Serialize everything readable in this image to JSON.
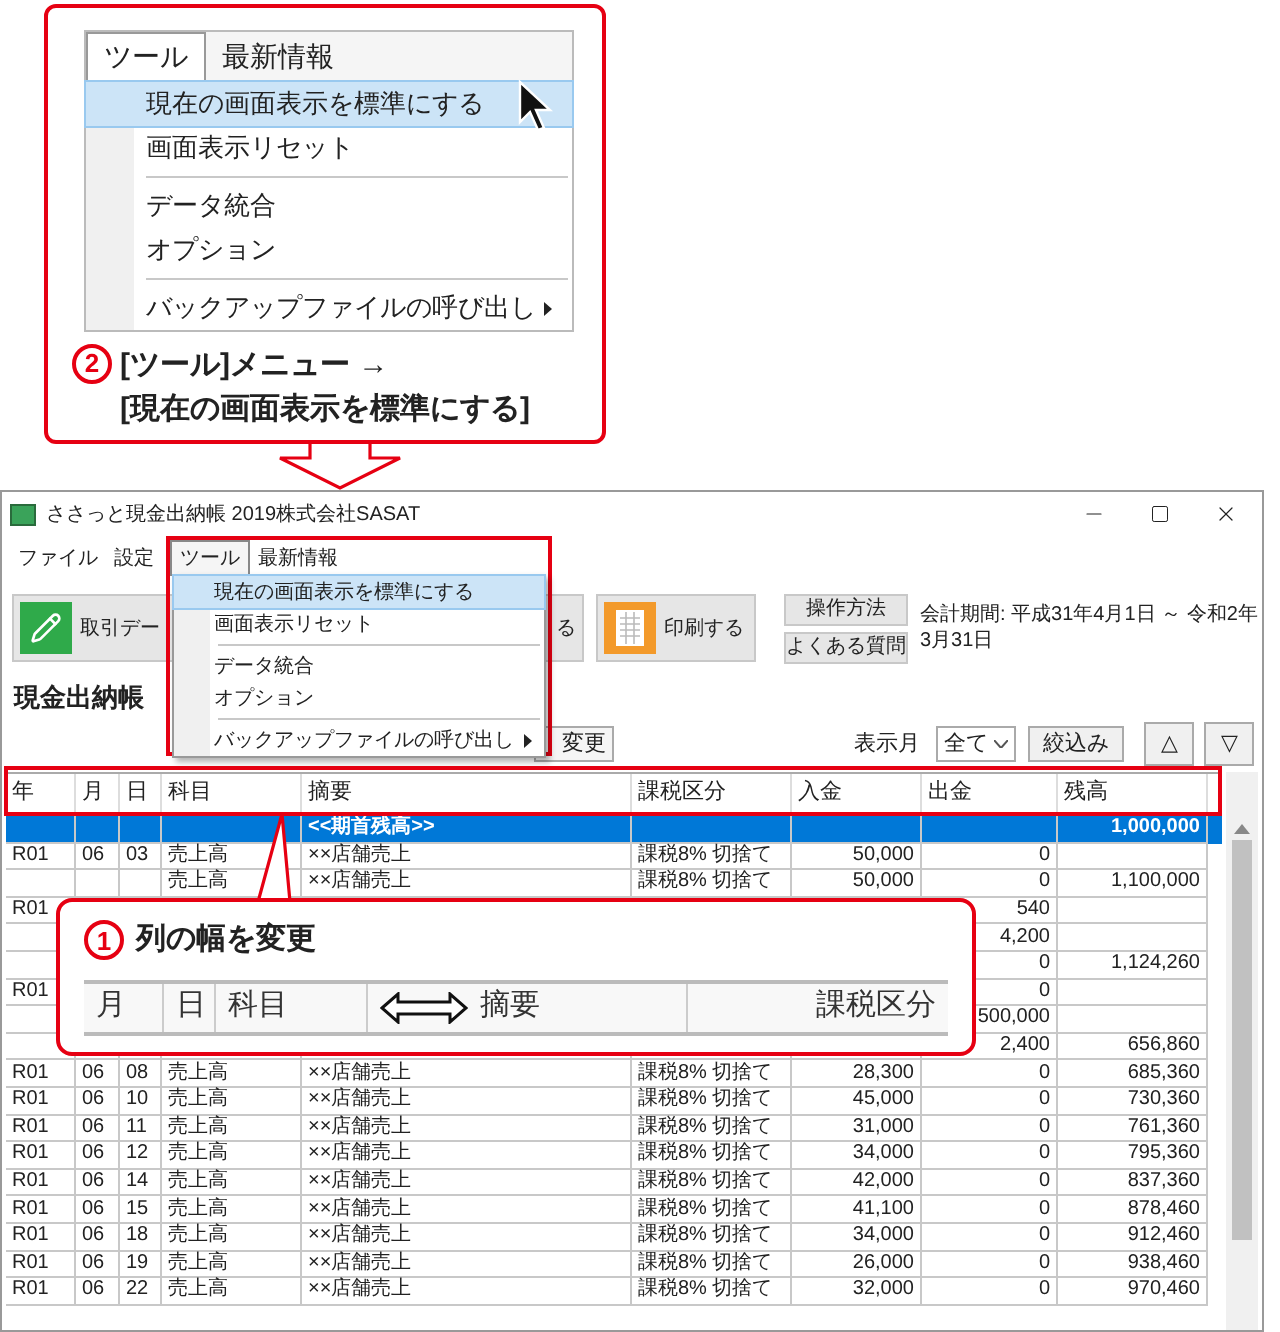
{
  "guide_menu": {
    "menus": [
      {
        "label": "ツール",
        "selected": true
      },
      {
        "label": "最新情報",
        "selected": false
      }
    ],
    "items": [
      {
        "kind": "item",
        "label": "現在の画面表示を標準にする",
        "selected": true,
        "submenu": false
      },
      {
        "kind": "item",
        "label": "画面表示リセット",
        "selected": false,
        "submenu": false
      },
      {
        "kind": "separator"
      },
      {
        "kind": "item",
        "label": "データ統合",
        "selected": false,
        "submenu": false
      },
      {
        "kind": "item",
        "label": "オプション",
        "selected": false,
        "submenu": false
      },
      {
        "kind": "separator"
      },
      {
        "kind": "item",
        "label": "バックアップファイルの呼び出し",
        "selected": false,
        "submenu": true
      }
    ]
  },
  "step2": {
    "number": "2",
    "lines": [
      "[ツール]メニュー →",
      "[現在の画面表示を標準にする]"
    ]
  },
  "window": {
    "title": "ささっと現金出納帳 2019株式会社SASAT"
  },
  "menubar": [
    {
      "label": "ファイル",
      "selected": false
    },
    {
      "label": "設定",
      "selected": false
    },
    {
      "label": "ツール",
      "selected": true
    },
    {
      "label": "最新情報",
      "selected": false
    }
  ],
  "tools_menu": [
    {
      "kind": "item",
      "label": "現在の画面表示を標準にする",
      "selected": true,
      "submenu": false
    },
    {
      "kind": "item",
      "label": "画面表示リセット",
      "selected": false,
      "submenu": false
    },
    {
      "kind": "separator"
    },
    {
      "kind": "item",
      "label": "データ統合",
      "selected": false,
      "submenu": false
    },
    {
      "kind": "item",
      "label": "オプション",
      "selected": false,
      "submenu": false
    },
    {
      "kind": "separator"
    },
    {
      "kind": "item",
      "label": "バックアップファイルの呼び出し",
      "selected": false,
      "submenu": true
    }
  ],
  "toolbar": [
    {
      "kind": "edit",
      "label": "取引デー"
    },
    {
      "kind": "plain",
      "label": "る"
    },
    {
      "kind": "print",
      "label": "印刷する"
    }
  ],
  "help_buttons": [
    "操作方法",
    "よくある質問"
  ],
  "period": "会計期間: 平成31年4月1日 ～ 令和2年3月31日",
  "page_tab": "現金出納帳",
  "change_button": "変更",
  "month_filter": {
    "label": "表示月",
    "value": "全て"
  },
  "filter_button": "絞込み",
  "nav_buttons": [
    "△",
    "▽"
  ],
  "table": {
    "columns": [
      "年",
      "月",
      "日",
      "科目",
      "摘要",
      "課税区分",
      "入金",
      "出金",
      "残高"
    ],
    "rows": [
      {
        "selected": true,
        "cells": [
          null,
          null,
          null,
          null,
          "<<期首残高>>",
          null,
          null,
          null,
          "1,000,000"
        ]
      },
      {
        "selected": false,
        "cells": [
          "R01",
          "06",
          "03",
          "売上高",
          "××店舗売上",
          "課税8% 切捨て",
          "50,000",
          "0",
          null
        ]
      },
      {
        "selected": false,
        "cells": [
          null,
          null,
          null,
          "売上高",
          "××店舗売上",
          "課税8% 切捨て",
          "50,000",
          "0",
          "1,100,000"
        ]
      },
      {
        "selected": false,
        "cells": [
          "R01",
          null,
          null,
          null,
          null,
          null,
          null,
          "540",
          null
        ]
      },
      {
        "selected": false,
        "cells": [
          null,
          null,
          null,
          null,
          null,
          null,
          null,
          "4,200",
          null
        ]
      },
      {
        "selected": false,
        "cells": [
          null,
          null,
          null,
          null,
          null,
          null,
          null,
          "0",
          "1,124,260"
        ]
      },
      {
        "selected": false,
        "cells": [
          "R01",
          null,
          null,
          null,
          null,
          null,
          null,
          "0",
          null
        ]
      },
      {
        "selected": false,
        "cells": [
          null,
          null,
          null,
          null,
          null,
          null,
          null,
          "500,000",
          null
        ]
      },
      {
        "selected": false,
        "cells": [
          null,
          null,
          null,
          null,
          null,
          null,
          null,
          "2,400",
          "656,860"
        ]
      },
      {
        "selected": false,
        "cells": [
          "R01",
          "06",
          "08",
          "売上高",
          "××店舗売上",
          "課税8% 切捨て",
          "28,300",
          "0",
          "685,360"
        ]
      },
      {
        "selected": false,
        "cells": [
          "R01",
          "06",
          "10",
          "売上高",
          "××店舗売上",
          "課税8% 切捨て",
          "45,000",
          "0",
          "730,360"
        ]
      },
      {
        "selected": false,
        "cells": [
          "R01",
          "06",
          "11",
          "売上高",
          "××店舗売上",
          "課税8% 切捨て",
          "31,000",
          "0",
          "761,360"
        ]
      },
      {
        "selected": false,
        "cells": [
          "R01",
          "06",
          "12",
          "売上高",
          "××店舗売上",
          "課税8% 切捨て",
          "34,000",
          "0",
          "795,360"
        ]
      },
      {
        "selected": false,
        "cells": [
          "R01",
          "06",
          "14",
          "売上高",
          "××店舗売上",
          "課税8% 切捨て",
          "42,000",
          "0",
          "837,360"
        ]
      },
      {
        "selected": false,
        "cells": [
          "R01",
          "06",
          "15",
          "売上高",
          "××店舗売上",
          "課税8% 切捨て",
          "41,100",
          "0",
          "878,460"
        ]
      },
      {
        "selected": false,
        "cells": [
          "R01",
          "06",
          "18",
          "売上高",
          "××店舗売上",
          "課税8% 切捨て",
          "34,000",
          "0",
          "912,460"
        ]
      },
      {
        "selected": false,
        "cells": [
          "R01",
          "06",
          "19",
          "売上高",
          "××店舗売上",
          "課税8% 切捨て",
          "26,000",
          "0",
          "938,460"
        ]
      },
      {
        "selected": false,
        "cells": [
          "R01",
          "06",
          "22",
          "売上高",
          "××店舗売上",
          "課税8% 切捨て",
          "32,000",
          "0",
          "970,460"
        ]
      }
    ]
  },
  "callout1": {
    "number": "1",
    "title": "列の幅を変更",
    "sample_columns": [
      "月",
      "日",
      "科目",
      "摘要",
      "課税区分"
    ]
  }
}
